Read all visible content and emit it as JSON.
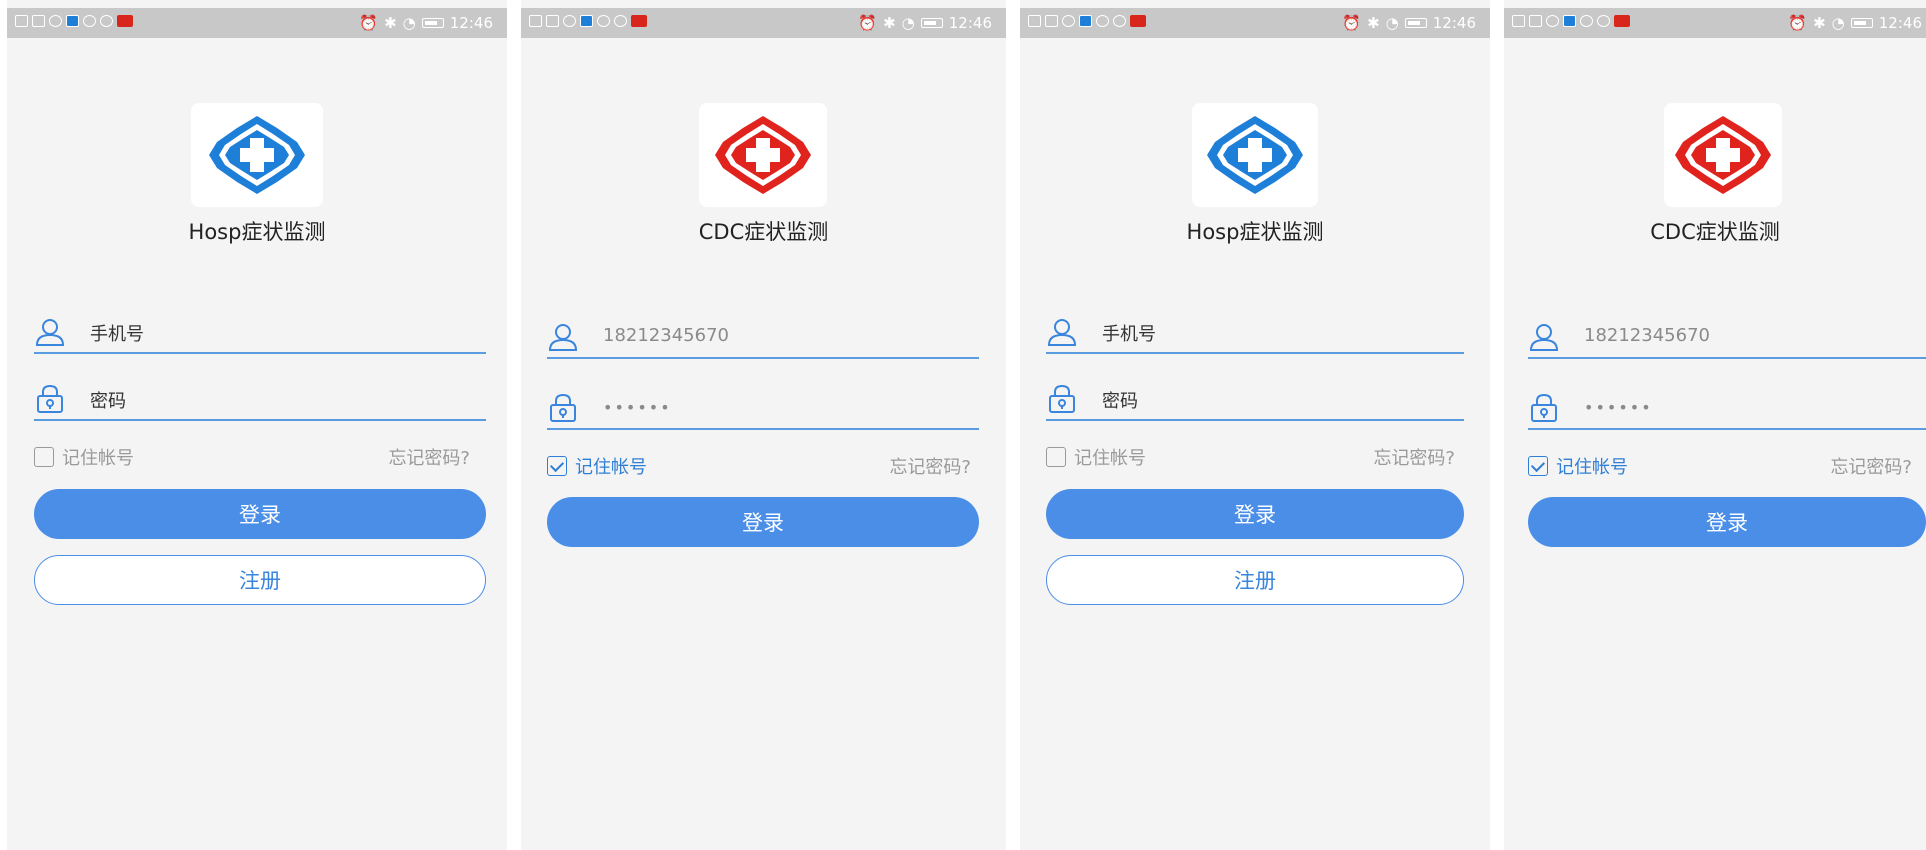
{
  "status_bar": {
    "time": "12:46"
  },
  "screens": [
    {
      "app_title": "Hosp症状监测",
      "logo_color": "#1e7fd8",
      "phone_value": "手机号",
      "password_value": "密码",
      "remember_label": "记住帐号",
      "remember_checked": false,
      "forgot_label": "忘记密码?",
      "login_label": "登录",
      "register_label": "注册"
    },
    {
      "app_title": "CDC症状监测",
      "logo_color": "#e0231c",
      "phone_value": "18212345670",
      "password_value": "••••••",
      "remember_label": "记住帐号",
      "remember_checked": true,
      "forgot_label": "忘记密码?",
      "login_label": "登录"
    },
    {
      "app_title": "Hosp症状监测",
      "logo_color": "#1e7fd8",
      "phone_value": "手机号",
      "password_value": "密码",
      "remember_label": "记住帐号",
      "remember_checked": false,
      "forgot_label": "忘记密码?",
      "login_label": "登录",
      "register_label": "注册"
    },
    {
      "app_title": "CDC症状监测",
      "logo_color": "#e0231c",
      "phone_value": "18212345670",
      "password_value": "••••••",
      "remember_label": "记住帐号",
      "remember_checked": true,
      "forgot_label": "忘记密码?",
      "login_label": "登录"
    }
  ]
}
